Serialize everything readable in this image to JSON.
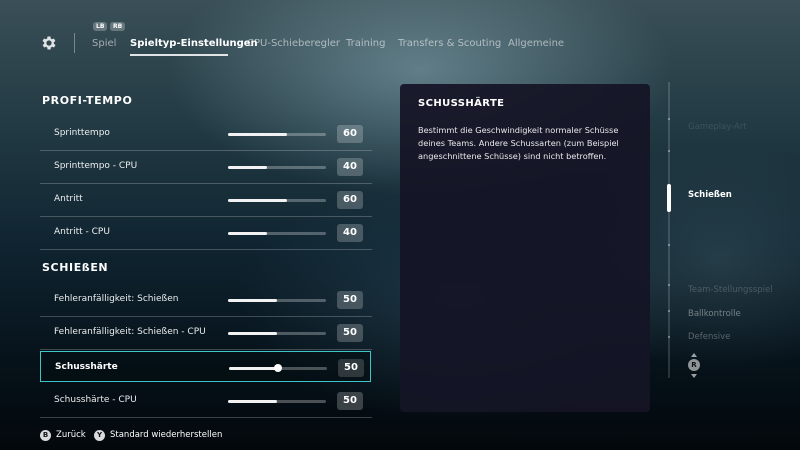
{
  "nav": {
    "bumper_left": "LB",
    "bumper_right": "RB",
    "tabs": [
      {
        "label": "Spiel"
      },
      {
        "label": "Spieltyp-Einstellungen"
      },
      {
        "label": "CPU-Schieberegler"
      },
      {
        "label": "Training"
      },
      {
        "label": "Transfers & Scouting"
      },
      {
        "label": "Allgemeine"
      }
    ],
    "active_tab": "Spieltyp-Einstellungen"
  },
  "sections": [
    {
      "title": "PROFI-TEMPO",
      "rows": [
        {
          "label": "Sprinttempo",
          "value": "60",
          "level": 0.6
        },
        {
          "label": "Sprinttempo - CPU",
          "value": "40",
          "level": 0.4
        },
        {
          "label": "Antritt",
          "value": "60",
          "level": 0.6
        },
        {
          "label": "Antritt - CPU",
          "value": "40",
          "level": 0.4
        }
      ]
    },
    {
      "title": "SCHIEßEN",
      "rows": [
        {
          "label": "Fehleranfälligkeit: Schießen",
          "value": "50",
          "level": 0.5
        },
        {
          "label": "Fehleranfälligkeit: Schießen - CPU",
          "value": "50",
          "level": 0.5
        },
        {
          "label": "Schusshärte",
          "value": "50",
          "level": 0.5,
          "selected": true
        },
        {
          "label": "Schusshärte - CPU",
          "value": "50",
          "level": 0.5
        }
      ]
    }
  ],
  "description": {
    "title": "SCHUSSHÄRTE",
    "body": "Bestimmt die Geschwindigkeit normaler Schüsse deines Teams. Andere Schussarten (zum Beispiel angeschnittene Schüsse) sind nicht betroffen."
  },
  "categories": {
    "items": [
      {
        "label": "Gameplay-Art",
        "opacity": 0.12
      },
      {
        "label": "Schießen",
        "opacity": 1.0,
        "active": true
      },
      {
        "label": "Team-Stellungsspiel",
        "opacity": 0.2
      },
      {
        "label": "Ballkontrolle",
        "opacity": 0.4
      },
      {
        "label": "Defensive",
        "opacity": 0.3
      }
    ],
    "scroll_button": "R"
  },
  "footer": {
    "back": {
      "button": "B",
      "label": "Zurück"
    },
    "reset": {
      "button": "Y",
      "label": "Standard wiederherstellen"
    }
  },
  "colors": {
    "accent": "#3fc4c8",
    "panel": "#141426"
  },
  "icons": {
    "settings": "gear-icon"
  }
}
